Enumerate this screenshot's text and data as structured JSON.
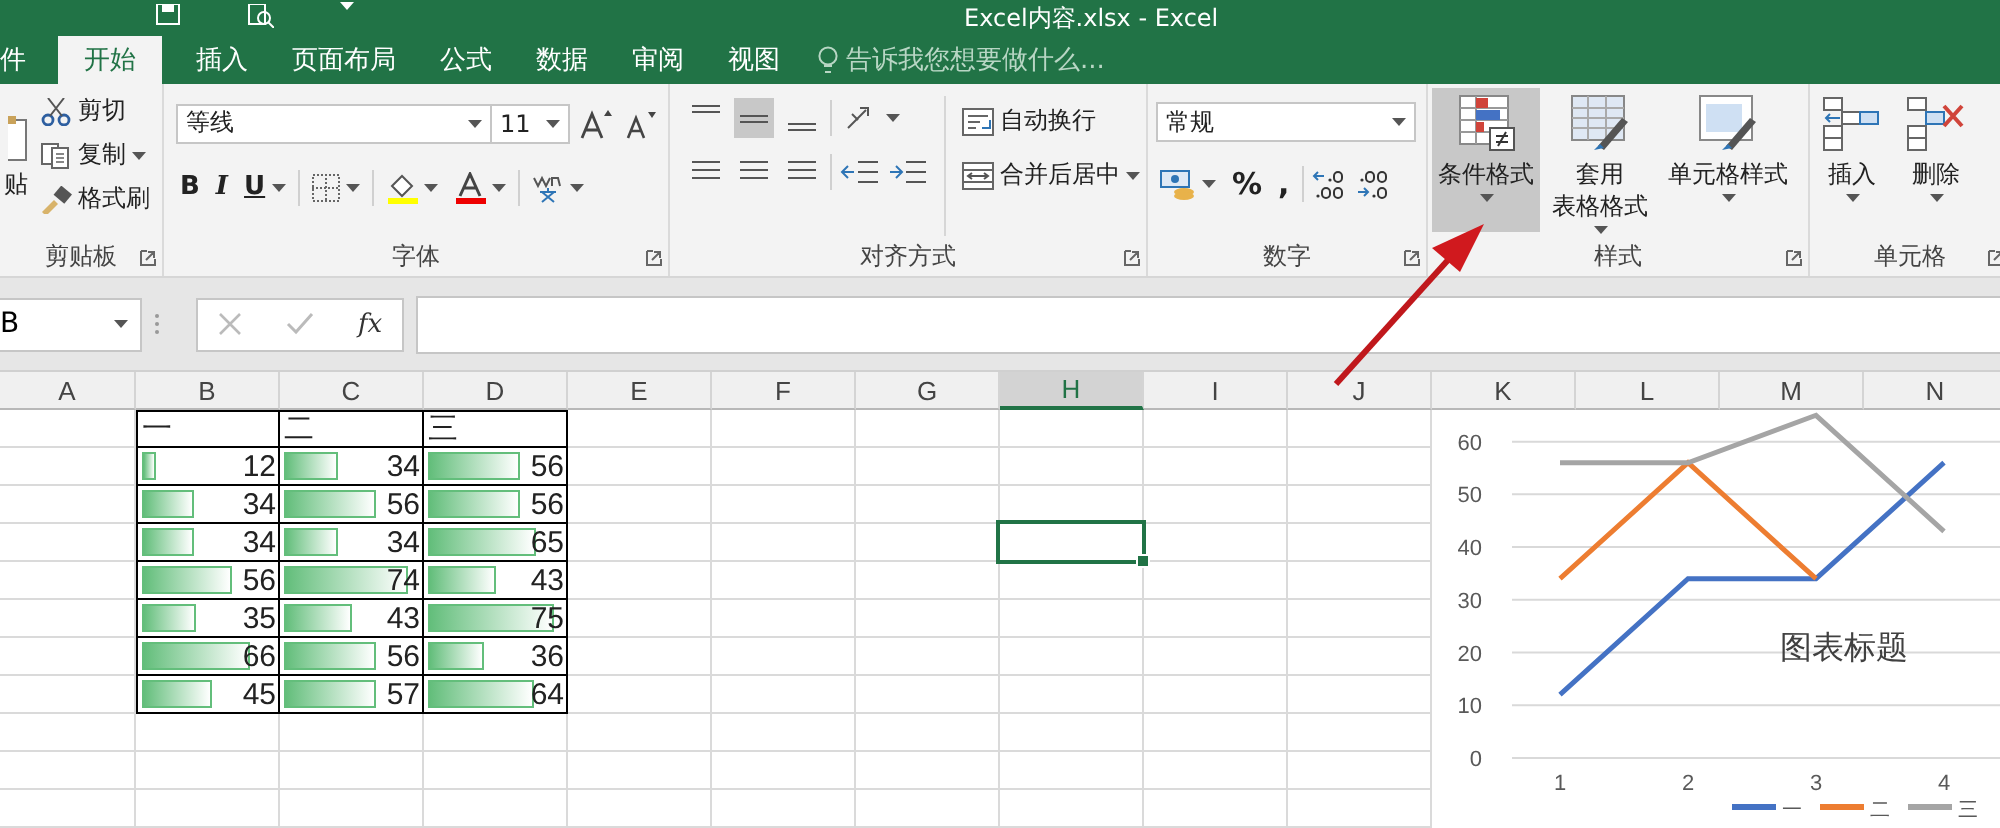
{
  "title_bar": {
    "title": "Excel内容.xlsx - Excel"
  },
  "tabs": [
    {
      "label": "件",
      "selected": false
    },
    {
      "label": "开始",
      "selected": true
    },
    {
      "label": "插入",
      "selected": false
    },
    {
      "label": "页面布局",
      "selected": false
    },
    {
      "label": "公式",
      "selected": false
    },
    {
      "label": "数据",
      "selected": false
    },
    {
      "label": "审阅",
      "selected": false
    },
    {
      "label": "视图",
      "selected": false
    }
  ],
  "tell_me": {
    "placeholder": "告诉我您想要做什么..."
  },
  "ribbon": {
    "clipboard": {
      "paste": "贴",
      "cut": "剪切",
      "copy": "复制",
      "format_painter": "格式刷",
      "label": "剪贴板"
    },
    "font": {
      "font_name": "等线",
      "font_size": "11",
      "bold": "B",
      "italic": "I",
      "underline": "U",
      "label": "字体"
    },
    "alignment": {
      "wrap_text": "自动换行",
      "merge_center": "合并后居中",
      "label": "对齐方式"
    },
    "number": {
      "format": "常规",
      "percent": "%",
      "comma": ",",
      "label": "数字"
    },
    "styles": {
      "buttons": [
        {
          "lines": [
            "条件格式"
          ],
          "selected": true
        },
        {
          "lines": [
            "套用",
            "表格格式"
          ],
          "selected": false
        },
        {
          "lines": [
            "单元格样式"
          ],
          "selected": false
        }
      ],
      "label": "样式"
    },
    "cells": {
      "buttons": [
        {
          "lines": [
            "插入"
          ]
        },
        {
          "lines": [
            "删除"
          ]
        }
      ],
      "label": "单元格"
    }
  },
  "formula_bar": {
    "name_box": "B",
    "function_button": "fx"
  },
  "sheet": {
    "columns": [
      {
        "label": "A",
        "selected": false
      },
      {
        "label": "B",
        "selected": false
      },
      {
        "label": "C",
        "selected": false
      },
      {
        "label": "D",
        "selected": false
      },
      {
        "label": "E",
        "selected": false
      },
      {
        "label": "F",
        "selected": false
      },
      {
        "label": "G",
        "selected": false
      },
      {
        "label": "H",
        "selected": true
      },
      {
        "label": "I",
        "selected": false
      },
      {
        "label": "J",
        "selected": false
      },
      {
        "label": "K",
        "selected": false
      },
      {
        "label": "L",
        "selected": false
      },
      {
        "label": "M",
        "selected": false
      },
      {
        "label": "N",
        "selected": false
      }
    ],
    "rows": [
      {
        "kind": "header",
        "cells": [
          "一",
          "二",
          "三"
        ],
        "selected": false
      },
      {
        "kind": "data",
        "cells": [
          {
            "value": "12",
            "level": 0.15
          },
          {
            "value": "34",
            "level": 0.43
          },
          {
            "value": "56",
            "level": 0.7
          }
        ],
        "selected": false
      },
      {
        "kind": "data",
        "cells": [
          {
            "value": "34",
            "level": 0.43
          },
          {
            "value": "56",
            "level": 0.7
          },
          {
            "value": "56",
            "level": 0.7
          }
        ],
        "selected": false
      },
      {
        "kind": "data",
        "cells": [
          {
            "value": "34",
            "level": 0.43
          },
          {
            "value": "34",
            "level": 0.43
          },
          {
            "value": "65",
            "level": 0.81
          }
        ],
        "selected": true
      },
      {
        "kind": "data",
        "cells": [
          {
            "value": "56",
            "level": 0.7
          },
          {
            "value": "74",
            "level": 0.93
          },
          {
            "value": "43",
            "level": 0.54
          }
        ],
        "selected": false
      },
      {
        "kind": "data",
        "cells": [
          {
            "value": "35",
            "level": 0.44
          },
          {
            "value": "43",
            "level": 0.54
          },
          {
            "value": "75",
            "level": 0.94
          }
        ],
        "selected": false
      },
      {
        "kind": "data",
        "cells": [
          {
            "value": "66",
            "level": 0.83
          },
          {
            "value": "56",
            "level": 0.7
          },
          {
            "value": "36",
            "level": 0.45
          }
        ],
        "selected": false
      },
      {
        "kind": "data",
        "cells": [
          {
            "value": "45",
            "level": 0.56
          },
          {
            "value": "57",
            "level": 0.71
          },
          {
            "value": "64",
            "level": 0.8
          }
        ],
        "selected": false
      },
      {
        "kind": "empty",
        "selected": false
      },
      {
        "kind": "empty",
        "selected": false
      },
      {
        "kind": "empty",
        "selected": false
      }
    ],
    "chart": {
      "chart_data": {
        "type": "line",
        "title": "图表标题",
        "categories": [
          "1",
          "2",
          "3",
          "4"
        ],
        "ylim": [
          0,
          66
        ],
        "grid": true,
        "legend": "bottom",
        "yticks": [
          0,
          10,
          20,
          30,
          40,
          50,
          60
        ],
        "series": [
          {
            "name": "一",
            "color": "#4472c4",
            "values": [
              12,
              34,
              34,
              56
            ]
          },
          {
            "name": "二",
            "color": "#ed7d31",
            "values": [
              34,
              56,
              34,
              null
            ]
          },
          {
            "name": "三",
            "color": "#a5a5a5",
            "values": [
              56,
              56,
              65,
              43
            ]
          }
        ]
      }
    }
  }
}
